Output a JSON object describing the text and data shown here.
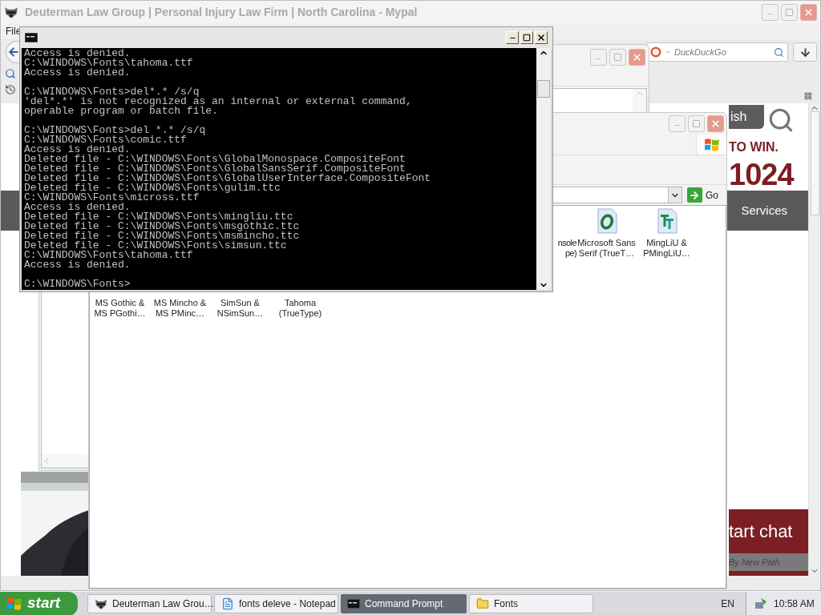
{
  "browser": {
    "title": "Deuterman Law Group | Personal Injury Law Firm | North Carolina - Mypal",
    "active": false,
    "menu": [
      "File"
    ],
    "search": {
      "placeholder": "DuckDuckGo"
    },
    "site": {
      "tab": "ish",
      "headline": "TO WIN.",
      "number": "1024",
      "nav": "Services",
      "chat": "tart chat",
      "chat_sub": "By New Path"
    }
  },
  "fonts_window": {
    "go": "Go",
    "rows": [
      [
        {
          "kind": "clipped",
          "lines": [
            "nsole",
            "pe)"
          ]
        },
        {
          "kind": "opentype",
          "lines": [
            "Microsoft Sans",
            "Serif (TrueT…"
          ]
        },
        {
          "kind": "truetype",
          "lines": [
            "MingLiU &",
            "PMingLiU…"
          ]
        }
      ],
      [
        {
          "kind": "covered",
          "lines": [
            "MS Gothic &",
            "MS PGothi…"
          ]
        },
        {
          "kind": "covered",
          "lines": [
            "MS Mincho &",
            "MS PMinc…"
          ]
        },
        {
          "kind": "covered",
          "lines": [
            "SimSun &",
            "NSimSun…"
          ]
        },
        {
          "kind": "covered",
          "lines": [
            "Tahoma",
            "(TrueType)"
          ]
        }
      ]
    ]
  },
  "console": {
    "blocks": [
      [
        "Access is denied.",
        "C:\\WINDOWS\\Fonts\\tahoma.ttf",
        "Access is denied."
      ],
      [
        "C:\\WINDOWS\\Fonts>del*.* /s/q",
        "'del*.*' is not recognized as an internal or external command,",
        "operable program or batch file."
      ],
      [
        "C:\\WINDOWS\\Fonts>del *.* /s/q",
        "C:\\WINDOWS\\Fonts\\comic.ttf",
        "Access is denied.",
        "Deleted file - C:\\WINDOWS\\Fonts\\GlobalMonospace.CompositeFont",
        "Deleted file - C:\\WINDOWS\\Fonts\\GlobalSansSerif.CompositeFont",
        "Deleted file - C:\\WINDOWS\\Fonts\\GlobalUserInterface.CompositeFont",
        "Deleted file - C:\\WINDOWS\\Fonts\\gulim.ttc",
        "C:\\WINDOWS\\Fonts\\micross.ttf",
        "Access is denied.",
        "Deleted file - C:\\WINDOWS\\Fonts\\mingliu.ttc",
        "Deleted file - C:\\WINDOWS\\Fonts\\msgothic.ttc",
        "Deleted file - C:\\WINDOWS\\Fonts\\msmincho.ttc",
        "Deleted file - C:\\WINDOWS\\Fonts\\simsun.ttc",
        "C:\\WINDOWS\\Fonts\\tahoma.ttf",
        "Access is denied."
      ],
      [
        "C:\\WINDOWS\\Fonts>"
      ]
    ]
  },
  "taskbar": {
    "start": "start",
    "tasks": [
      {
        "kind": "browser",
        "label": "Deuterman Law Grou…",
        "selected": false
      },
      {
        "kind": "notepad",
        "label": "fonts deleve - Notepad",
        "selected": false
      },
      {
        "kind": "console",
        "label": "Command Prompt",
        "selected": true
      },
      {
        "kind": "folder",
        "label": "Fonts",
        "selected": false
      }
    ],
    "language": "EN",
    "clock": "10:58 AM"
  }
}
